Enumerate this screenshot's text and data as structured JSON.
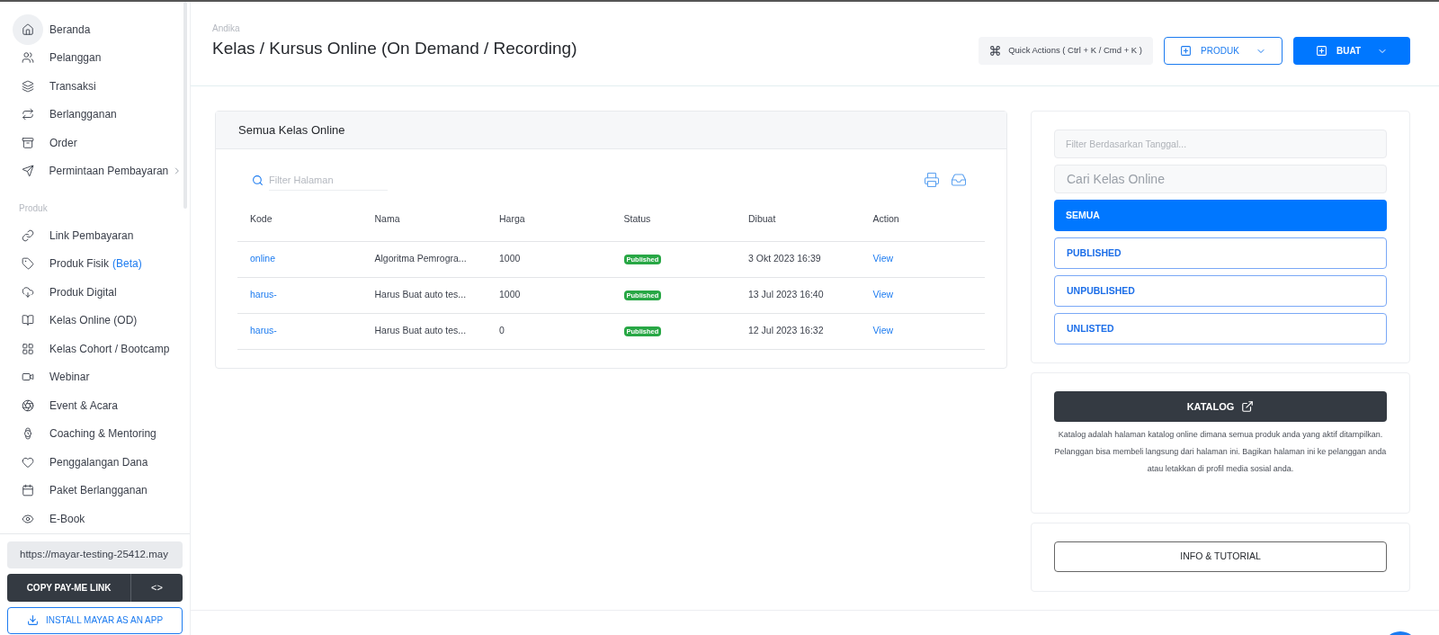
{
  "sidebar": {
    "items": [
      {
        "label": "Beranda",
        "selected": true
      },
      {
        "label": "Pelanggan",
        "selected": false
      },
      {
        "label": "Transaksi",
        "selected": false
      },
      {
        "label": "Berlangganan",
        "selected": false
      },
      {
        "label": "Order",
        "selected": false
      },
      {
        "label": "Permintaan Pembayaran",
        "selected": false,
        "has_submenu": true
      }
    ],
    "section_label": "Produk",
    "product_items": [
      {
        "label": "Link Pembayaran",
        "selected": false
      },
      {
        "label": "Produk Fisik",
        "badge": "(Beta)",
        "selected": false
      },
      {
        "label": "Produk Digital",
        "selected": false
      },
      {
        "label": "Kelas Online (OD)",
        "selected": false
      },
      {
        "label": "Kelas Cohort / Bootcamp",
        "selected": false
      },
      {
        "label": "Webinar",
        "selected": false
      },
      {
        "label": "Event & Acara",
        "selected": false
      },
      {
        "label": "Coaching & Mentoring",
        "selected": false
      },
      {
        "label": "Penggalangan Dana",
        "selected": false
      },
      {
        "label": "Paket Berlangganan",
        "selected": false
      },
      {
        "label": "E-Book",
        "selected": false
      }
    ],
    "link_value": "https://mayar-testing-25412.may",
    "copy_button": "COPY PAY-ME LINK",
    "embed_button": "<>",
    "install_button": "INSTALL MAYAR AS AN APP"
  },
  "header": {
    "breadcrumb": "Andika",
    "title": "Kelas / Kursus Online (On Demand / Recording)",
    "quick_actions": "Quick Actions ( Ctrl + K / Cmd + K )",
    "produk_button": "PRODUK",
    "buat_button": "BUAT"
  },
  "table_card": {
    "title": "Semua Kelas Online",
    "filter_placeholder": "Filter Halaman",
    "columns": [
      "Kode",
      "Nama",
      "Harga",
      "Status",
      "Dibuat",
      "Action"
    ],
    "rows": [
      {
        "kode": "online",
        "nama": "Algoritma Pemrogra...",
        "harga": "1000",
        "status": "Published",
        "dibuat": "3 Okt 2023 16:39",
        "action": "View"
      },
      {
        "kode": "harus-",
        "nama": "Harus Buat auto tes...",
        "harga": "1000",
        "status": "Published",
        "dibuat": "13 Jul 2023 16:40",
        "action": "View"
      },
      {
        "kode": "harus-",
        "nama": "Harus Buat auto tes...",
        "harga": "0",
        "status": "Published",
        "dibuat": "12 Jul 2023 16:32",
        "action": "View"
      }
    ]
  },
  "filter_panel": {
    "date_placeholder": "Filter Berdasarkan Tanggal...",
    "search_placeholder": "Cari Kelas Online",
    "filters": [
      {
        "label": "SEMUA",
        "selected": true
      },
      {
        "label": "PUBLISHED",
        "selected": false
      },
      {
        "label": "UNPUBLISHED",
        "selected": false
      },
      {
        "label": "UNLISTED",
        "selected": false
      }
    ]
  },
  "katalog": {
    "button": "KATALOG",
    "description": "Katalog adalah halaman katalog online dimana semua produk anda yang aktif ditampilkan. Pelanggan bisa membeli langsung dari halaman ini. Bagikan halaman ini ke pelanggan anda atau letakkan di profil media sosial anda."
  },
  "info_button": "INFO & TUTORIAL"
}
